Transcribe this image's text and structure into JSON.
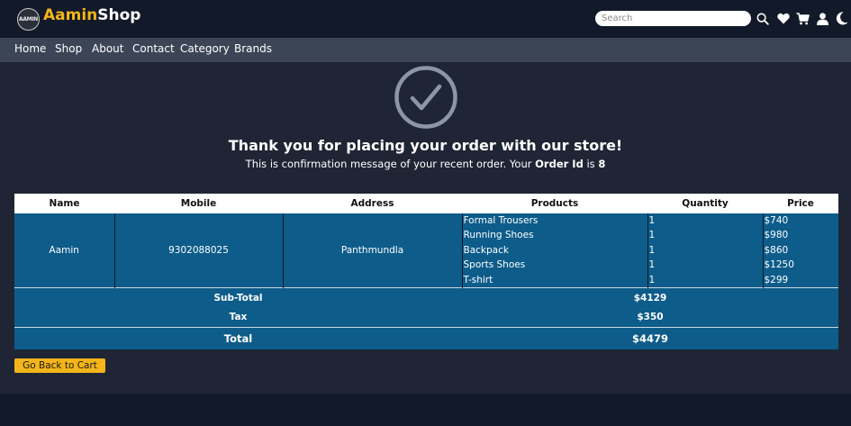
{
  "header": {
    "logo_text": "AAMIN",
    "brand_part1": "Aamin",
    "brand_part2": "Shop",
    "search_placeholder": "Search",
    "icons": [
      "search-icon",
      "heart-icon",
      "cart-icon",
      "user-icon",
      "moon-icon"
    ]
  },
  "nav": {
    "items": [
      "Home",
      "Shop",
      "About",
      "Contact",
      "Category",
      "Brands"
    ]
  },
  "confirmation": {
    "title": "Thank you for placing your order with our store!",
    "message_prefix": "This is confirmation message of your recent order. Your ",
    "order_id_label": "Order Id",
    "message_mid": " is ",
    "order_id": "8"
  },
  "order_table": {
    "headers": [
      "Name",
      "Mobile",
      "Address",
      "Products",
      "Quantity",
      "Price"
    ],
    "customer": {
      "name": "Aamin",
      "mobile": "9302088025",
      "address": "Panthmundla"
    },
    "products": [
      {
        "name": "Formal Trousers",
        "quantity": "1",
        "price": "$740"
      },
      {
        "name": "Running Shoes",
        "quantity": "1",
        "price": "$980"
      },
      {
        "name": "Backpack",
        "quantity": "1",
        "price": "$860"
      },
      {
        "name": "Sports Shoes",
        "quantity": "1",
        "price": "$1250"
      },
      {
        "name": "T-shirt",
        "quantity": "1",
        "price": "$299"
      }
    ],
    "subtotal_label": "Sub-Total",
    "subtotal_value": "$4129",
    "tax_label": "Tax",
    "tax_value": "$350",
    "total_label": "Total",
    "total_value": "$4479"
  },
  "actions": {
    "back_button": "Go Back to Cart"
  },
  "colors": {
    "accent": "#f4b51a",
    "table_row_bg": "#0d5c8a",
    "page_bg": "#1f2535",
    "header_bg": "#121a2a",
    "nav_bg": "#3b4556"
  }
}
